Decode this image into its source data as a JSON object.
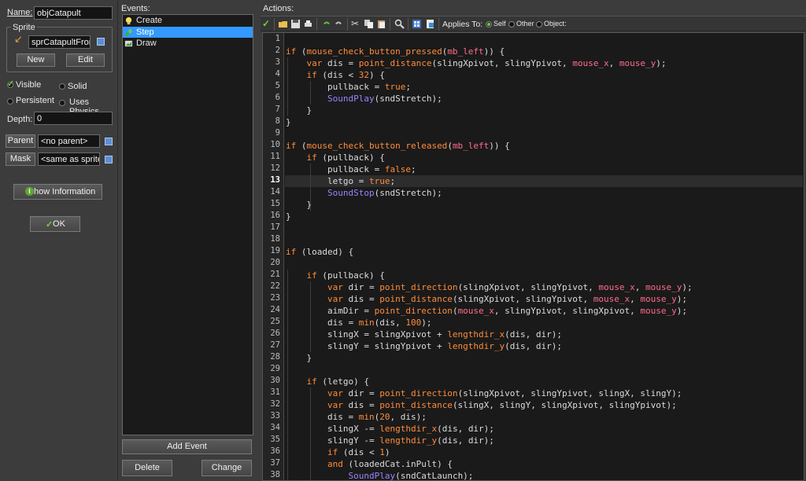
{
  "props": {
    "name_label": "Name:",
    "name_value": "objCatapult",
    "sprite_group_label": "Sprite",
    "sprite_value": "sprCatapultFront",
    "new_button": "New",
    "edit_button": "Edit",
    "visible_label": "Visible",
    "solid_label": "Solid",
    "persistent_label": "Persistent",
    "uses_physics_label": "Uses Physics",
    "depth_label": "Depth:",
    "depth_value": "0",
    "parent_button": "Parent",
    "parent_value": "<no parent>",
    "mask_button": "Mask",
    "mask_value": "<same as sprite>",
    "show_info_button": "Show Information",
    "ok_button": "OK"
  },
  "events": {
    "title": "Events:",
    "items": [
      {
        "label": "Create",
        "icon": "lightbulb-icon"
      },
      {
        "label": "Step",
        "icon": "steps-icon"
      },
      {
        "label": "Draw",
        "icon": "paint-icon"
      }
    ],
    "add_event_button": "Add Event",
    "delete_button": "Delete",
    "change_button": "Change"
  },
  "actions": {
    "title": "Actions:",
    "applies_to_label": "Applies To:",
    "self_label": "Self",
    "other_label": "Other",
    "object_label": "Object:",
    "current_line": 13,
    "code_lines": [
      "",
      "if (mouse_check_button_pressed(mb_left)) {",
      "    var dis = point_distance(slingXpivot, slingYpivot, mouse_x, mouse_y);",
      "    if (dis < 32) {",
      "        pullback = true;",
      "        SoundPlay(sndStretch);",
      "    }",
      "}",
      "",
      "if (mouse_check_button_released(mb_left)) {",
      "    if (pullback) {",
      "        pullback = false;",
      "        letgo = true;",
      "        SoundStop(sndStretch);",
      "    }",
      "}",
      "",
      "",
      "if (loaded) {",
      "",
      "    if (pullback) {",
      "        var dir = point_direction(slingXpivot, slingYpivot, mouse_x, mouse_y);",
      "        var dis = point_distance(slingXpivot, slingYpivot, mouse_x, mouse_y);",
      "        aimDir = point_direction(mouse_x, slingYpivot, slingXpivot, mouse_y);",
      "        dis = min(dis, 100);",
      "        slingX = slingXpivot + lengthdir_x(dis, dir);",
      "        slingY = slingYpivot + lengthdir_y(dis, dir);",
      "    }",
      "",
      "    if (letgo) {",
      "        var dir = point_direction(slingXpivot, slingYpivot, slingX, slingY);",
      "        var dis = point_distance(slingX, slingY, slingXpivot, slingYpivot);",
      "        dis = min(20, dis);",
      "        slingX -= lengthdir_x(dis, dir);",
      "        slingY -= lengthdir_y(dis, dir);",
      "        if (dis < 1)",
      "        and (loadedCat.inPult) {",
      "            SoundPlay(sndCatLaunch);"
    ]
  }
}
